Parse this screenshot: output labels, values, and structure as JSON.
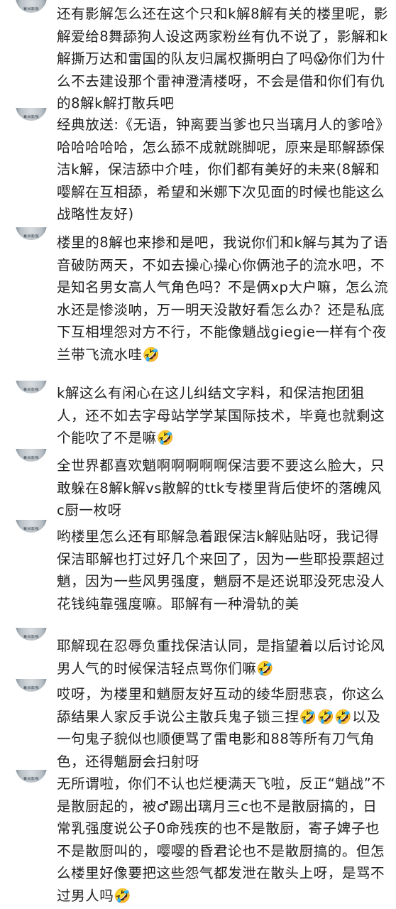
{
  "avatar": {
    "label": "暴风影视"
  },
  "comments": [
    {
      "text": "还有影解怎么还在这个只和k解8解有关的楼里呢，影解爱给8舞舔狗人设这两家粉丝有仇不说了，影解和k解撕万达和雷国的队友归属权撕明白了吗😱你们为什么不去建设那个雷神澄清楼呀，不会是借和你们有仇的8解k解打散兵吧"
    },
    {
      "text": "经典放送:《无语，钟离要当爹也只当璃月人的爹哈》哈哈哈哈哈，怎么舔不成就跳脚呢，原来是耶解舔保洁k解，保洁舔中介哇，你们都有美好的未来(8解和嘤解在互相舔，希望和米娜下次见面的时候也能这么战略性友好)"
    },
    {
      "text": "楼里的8解也来掺和是吧，我说你们和k解与其为了语音破防两天，不如去操心操心你俩池子的流水吧，不是知名男女高人气角色吗？不是俩xp大户嘛，怎么流水还是惨淡呐，万一明天没散好看怎么办？还是私底下互相埋怨对方不行，不能像魈战giegie一样有个夜兰带飞流水哇🤣"
    },
    {
      "text": "k解这么有闲心在这儿纠结文字料，和保洁抱团狙人，还不如去字母站学学某国际技术，毕竟也就剩这个能吹了不是嘛🤣"
    },
    {
      "text": "全世界都喜欢魈啊啊啊啊啊保洁要不要这么脸大，只敢躲在8解k解vs散解的ttk专楼里背后使坏的落魄风c厨一枚呀"
    },
    {
      "text": "哟楼里怎么还有耶解急着跟保洁k解贴贴呀，我记得保洁耶解也打过好几个来回了，因为一些耶投票超过魈，因为一些风男强度，魈厨不是还说耶没死忠没人花钱纯靠强度嘛。耶解有一种滑轨的美"
    },
    {
      "text": "耶解现在忍辱负重找保洁认同，是指望着以后讨论风男人气的时候保洁轻点骂你们嘛🤣"
    },
    {
      "text": "哎呀，为楼里和魈厨友好互动的绫华厨悲哀，你这么舔结果人家反手说公主散兵鬼子锁三捏🤣🤣🤣以及一句鬼子貌似也顺便骂了雷电影和88等所有刀气角色，还得魈厨会扫射呀"
    },
    {
      "text": "无所谓啦，你们不认也烂梗满天飞啦，反正“魈战”不是散厨起的，被♂踢出璃月三c也不是散厨搞的，日常乳强度说公子0命残疾的也不是散厨，寄子婢子也不是散厨叫的，嘤嘤的昏君论也不是散厨搞的。但怎么楼里好像要把这些怨气都发泄在散头上呀，是骂不过男人吗🤣"
    }
  ]
}
